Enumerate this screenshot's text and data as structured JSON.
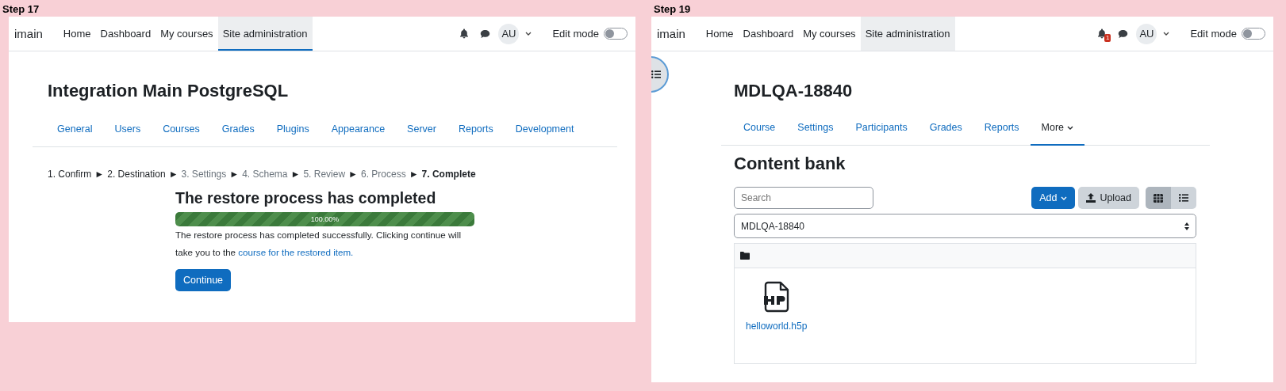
{
  "restore_screen": {
    "step_label": "Step 17",
    "navbar": {
      "brand": "imain",
      "items": [
        {
          "label": "Home",
          "selected": false,
          "highlighted": false
        },
        {
          "label": "Dashboard",
          "selected": false,
          "highlighted": false
        },
        {
          "label": "My courses",
          "selected": false,
          "highlighted": false
        },
        {
          "label": "Site administration",
          "selected": true,
          "highlighted": true
        }
      ],
      "avatar": "AU",
      "edit_mode": {
        "label": "Edit mode",
        "on": false
      }
    },
    "title": "Integration Main PostgreSQL",
    "tabs": [
      {
        "label": "General"
      },
      {
        "label": "Users"
      },
      {
        "label": "Courses"
      },
      {
        "label": "Grades"
      },
      {
        "label": "Plugins"
      },
      {
        "label": "Appearance"
      },
      {
        "label": "Server"
      },
      {
        "label": "Reports"
      },
      {
        "label": "Development"
      }
    ],
    "steps": [
      {
        "label": "1. Confirm",
        "disabled": false,
        "current": false,
        "separator": "►"
      },
      {
        "label": "2. Destination",
        "disabled": false,
        "current": false,
        "separator": "►"
      },
      {
        "label": "3. Settings",
        "disabled": true,
        "current": false,
        "separator": "►"
      },
      {
        "label": "4. Schema",
        "disabled": true,
        "current": false,
        "separator": "►"
      },
      {
        "label": "5. Review",
        "disabled": true,
        "current": false,
        "separator": "►"
      },
      {
        "label": "6. Process",
        "disabled": true,
        "current": false,
        "separator": "►"
      },
      {
        "label": "7. Complete",
        "disabled": false,
        "current": true
      }
    ],
    "heading": "The restore process has completed",
    "progress": {
      "level": 1,
      "label": "100.00%"
    },
    "message": "The restore process has completed successfully. Clicking continue will take you to the ",
    "message_link": "course for the restored item.",
    "continue_button": "Continue"
  },
  "content_bank_screen": {
    "step_label": "Step 19",
    "navbar": {
      "brand": "imain",
      "items": [
        {
          "label": "Home",
          "selected": false,
          "highlighted": false
        },
        {
          "label": "Dashboard",
          "selected": false,
          "highlighted": false
        },
        {
          "label": "My courses",
          "selected": false,
          "highlighted": false
        },
        {
          "label": "Site administration",
          "selected": false,
          "highlighted": true
        }
      ],
      "notification_count": "1",
      "avatar": "AU",
      "edit_mode": {
        "label": "Edit mode",
        "on": false
      }
    },
    "title": "MDLQA-18840",
    "tabs": [
      {
        "label": "Course",
        "selected": false,
        "dropdown": false
      },
      {
        "label": "Settings",
        "selected": false,
        "dropdown": false
      },
      {
        "label": "Participants",
        "selected": false,
        "dropdown": false
      },
      {
        "label": "Grades",
        "selected": false,
        "dropdown": false
      },
      {
        "label": "Reports",
        "selected": false,
        "dropdown": false
      },
      {
        "label": "More",
        "selected": true,
        "dropdown": true
      }
    ],
    "heading": "Content bank",
    "search": {
      "placeholder": "Search"
    },
    "add_button": "Add",
    "upload_button": "Upload",
    "views": [
      {
        "kind": "grid",
        "selected": true
      },
      {
        "kind": "list",
        "selected": false
      }
    ],
    "context_select": "MDLQA-18840",
    "files": [
      {
        "name": "helloworld.h5p"
      }
    ]
  }
}
